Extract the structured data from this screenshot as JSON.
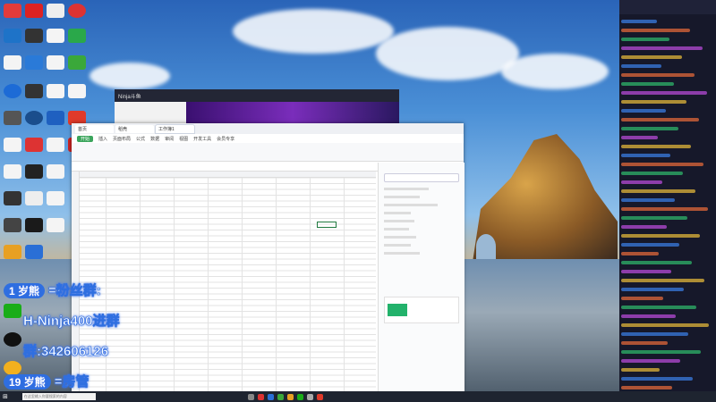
{
  "overlay": {
    "line1_badge": "1 岁熊",
    "line1_text": "=粉丝群:",
    "line2_text": "H-Ninja400进群",
    "line3_text": "群:342606126",
    "line4_badge": "19 岁熊",
    "line4_text": "=房管"
  },
  "stream_window": {
    "title": "Ninja斗鱼"
  },
  "wps": {
    "tabs": [
      "首页",
      "稻壳",
      "工作簿1"
    ],
    "menus": [
      "开始",
      "插入",
      "页面布局",
      "公式",
      "数据",
      "审阅",
      "视图",
      "开发工具",
      "会员专享"
    ],
    "active_menu": "开始"
  },
  "taskbar": {
    "search_placeholder": "在这里输入你要搜索的内容"
  },
  "colors": {
    "overlay_stroke": "#2f6fe0",
    "accent_green": "#3ba55c",
    "chat_bg": "#16182a"
  }
}
